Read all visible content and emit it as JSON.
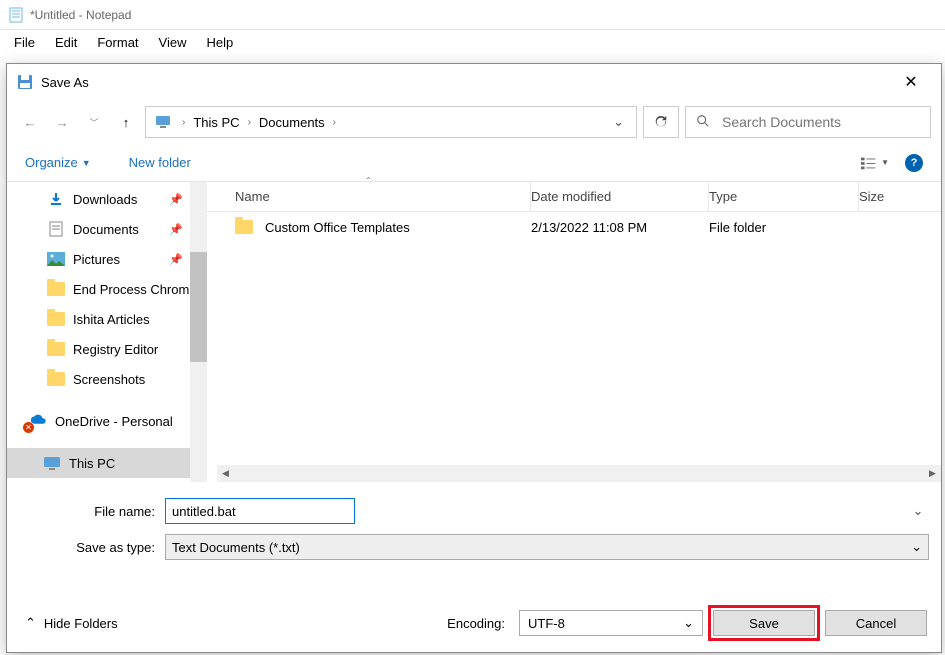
{
  "notepad": {
    "title": "*Untitled - Notepad",
    "menu": {
      "file": "File",
      "edit": "Edit",
      "format": "Format",
      "view": "View",
      "help": "Help"
    }
  },
  "dialog": {
    "title": "Save As",
    "breadcrumb": {
      "pc": "This PC",
      "docs": "Documents"
    },
    "search_placeholder": "Search Documents",
    "toolbar": {
      "organize": "Organize",
      "new_folder": "New folder"
    },
    "tree": {
      "downloads": "Downloads",
      "documents": "Documents",
      "pictures": "Pictures",
      "end_process": "End Process Chrom",
      "ishita": "Ishita Articles",
      "registry": "Registry Editor",
      "screenshots": "Screenshots",
      "onedrive": "OneDrive - Personal",
      "this_pc": "This PC"
    },
    "columns": {
      "name": "Name",
      "date": "Date modified",
      "type": "Type",
      "size": "Size"
    },
    "rows": [
      {
        "name": "Custom Office Templates",
        "date": "2/13/2022 11:08 PM",
        "type": "File folder"
      }
    ],
    "form": {
      "filename_label": "File name:",
      "filename_value": "untitled.bat",
      "type_label": "Save as type:",
      "type_value": "Text Documents (*.txt)"
    },
    "footer": {
      "hide": "Hide Folders",
      "encoding_label": "Encoding:",
      "encoding_value": "UTF-8",
      "save": "Save",
      "cancel": "Cancel"
    }
  }
}
